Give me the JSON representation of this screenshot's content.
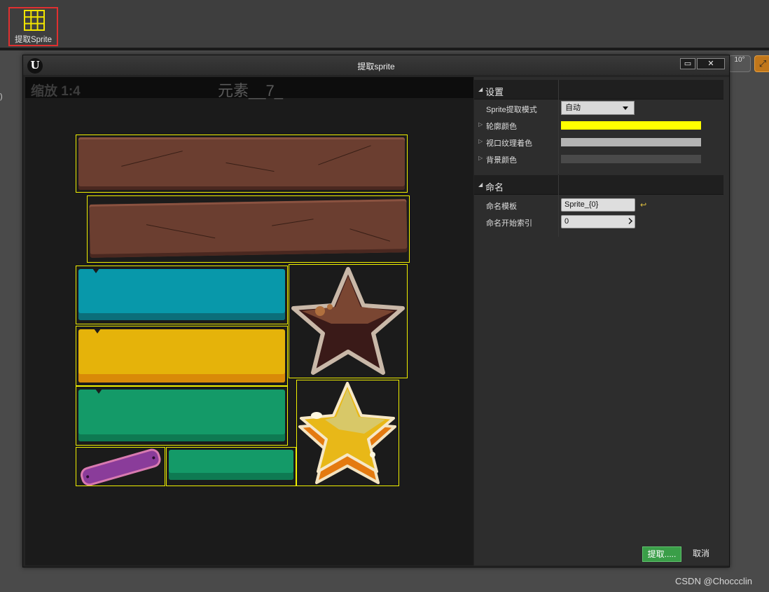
{
  "toolbar": {
    "extract_button_label": "提取Sprite",
    "angle_value": "10°"
  },
  "dialog": {
    "title": "提取sprite",
    "viewport": {
      "zoom_label": "缩放 1:4",
      "element_label": "元素__7_"
    },
    "settings": {
      "section_title": "设置",
      "mode_label": "Sprite提取模式",
      "mode_value": "自动",
      "outline_color_label": "轮廓颜色",
      "outline_color": "#ffff00",
      "viewport_tint_label": "视口纹理着色",
      "viewport_tint_color": "#b4b4b4",
      "background_color_label": "背景颜色",
      "background_color": "#4a4a4a"
    },
    "naming": {
      "section_title": "命名",
      "template_label": "命名模板",
      "template_value": "Sprite_{0}",
      "start_index_label": "命名开始索引",
      "start_index_value": "0"
    },
    "buttons": {
      "extract": "提取.....",
      "cancel": "取消"
    }
  },
  "watermark": "CSDN @Choccclin",
  "colors": {
    "outline": "#f0f000",
    "extract_button": "#3a9e48",
    "highlight": "#e03030"
  }
}
